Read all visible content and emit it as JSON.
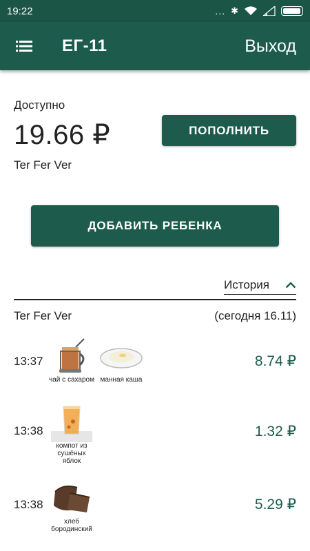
{
  "status_bar": {
    "time": "19:22",
    "dots": "...",
    "bluetooth": "✱",
    "battery_level": 0.95
  },
  "appbar": {
    "title": "ЕГ-11",
    "logout_label": "Выход"
  },
  "account": {
    "available_label": "Доступно",
    "balance": "19.66 ₽",
    "owner_name": "Ter Fer Ver",
    "topup_label": "ПОПОЛНИТЬ",
    "add_child_label": "ДОБАВИТЬ РЕБЕНКА"
  },
  "history": {
    "toggle_label": "История",
    "owner_name": "Ter Fer Ver",
    "date_label": "(сегодня 16.11)",
    "rows": [
      {
        "time": "13:37",
        "amount": "8.74 ₽",
        "items": [
          {
            "name": "чай с сахаром",
            "icon": "tea-glass-icon"
          },
          {
            "name": "манная каша",
            "icon": "porridge-bowl-icon"
          }
        ]
      },
      {
        "time": "13:38",
        "amount": "1.32 ₽",
        "items": [
          {
            "name": "компот из сушёных яблок",
            "icon": "compote-glass-icon"
          }
        ]
      },
      {
        "time": "13:38",
        "amount": "5.29 ₽",
        "items": [
          {
            "name": "хлеб бородинский",
            "icon": "bread-icon"
          }
        ]
      }
    ]
  }
}
